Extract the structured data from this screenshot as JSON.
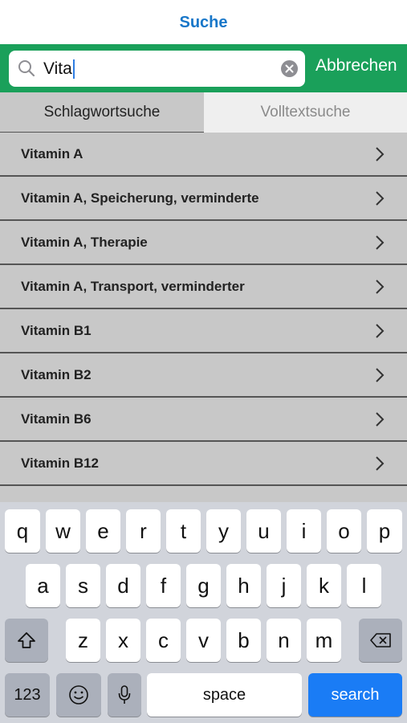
{
  "nav": {
    "title": "Suche"
  },
  "search": {
    "value": "Vita",
    "cancel_label": "Abbrechen"
  },
  "tabs": [
    {
      "label": "Schlagwortsuche",
      "active": true
    },
    {
      "label": "Volltextsuche",
      "active": false
    }
  ],
  "results": [
    {
      "label": "Vitamin A"
    },
    {
      "label": "Vitamin A, Speicherung, verminderte"
    },
    {
      "label": "Vitamin A, Therapie"
    },
    {
      "label": "Vitamin A, Transport, verminderter"
    },
    {
      "label": "Vitamin B1"
    },
    {
      "label": "Vitamin B2"
    },
    {
      "label": "Vitamin B6"
    },
    {
      "label": "Vitamin B12"
    }
  ],
  "keyboard": {
    "row1": [
      "q",
      "w",
      "e",
      "r",
      "t",
      "y",
      "u",
      "i",
      "o",
      "p"
    ],
    "row2": [
      "a",
      "s",
      "d",
      "f",
      "g",
      "h",
      "j",
      "k",
      "l"
    ],
    "row3": [
      "z",
      "x",
      "c",
      "v",
      "b",
      "n",
      "m"
    ],
    "numbers_label": "123",
    "space_label": "space",
    "search_label": "search"
  },
  "colors": {
    "accent": "#1aa05a",
    "title": "#1877c9",
    "search_key": "#1a7cf5"
  }
}
